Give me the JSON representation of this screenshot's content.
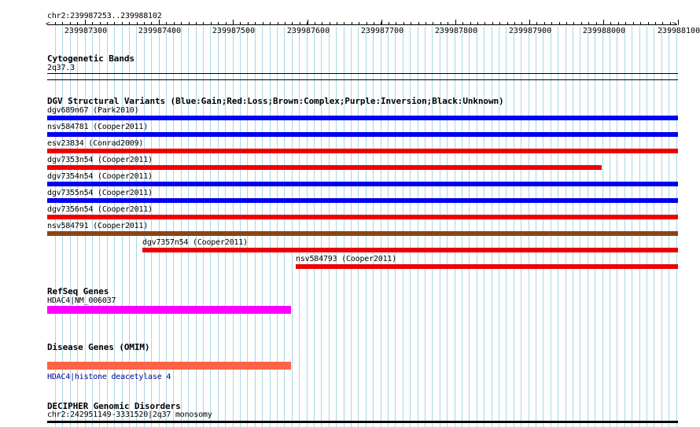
{
  "ruler": {
    "location": "chr2:239987253..239988102",
    "ticks": [
      "239987300",
      "239987400",
      "239987500",
      "239987600",
      "239987700",
      "239987800",
      "239987900",
      "239988000",
      "239988100"
    ]
  },
  "cytoband": {
    "title": "Cytogenetic Bands",
    "label": "2q37.3"
  },
  "dgv": {
    "title": "DGV Structural Variants (Blue:Gain;Red:Loss;Brown:Complex;Purple:Inversion;Black:Unknown)",
    "colors": {
      "gain": "#0000ee",
      "loss": "#ee0000",
      "complex": "#8b4513"
    },
    "variants": [
      {
        "label": "dgv689n67 (Park2010)",
        "type": "gain"
      },
      {
        "label": "nsv584781 (Cooper2011)",
        "type": "gain"
      },
      {
        "label": "esv23834 (Conrad2009)",
        "type": "loss"
      },
      {
        "label": "dgv7353n54 (Cooper2011)",
        "type": "loss"
      },
      {
        "label": "dgv7354n54 (Cooper2011)",
        "type": "gain"
      },
      {
        "label": "dgv7355n54 (Cooper2011)",
        "type": "gain"
      },
      {
        "label": "dgv7356n54 (Cooper2011)",
        "type": "loss"
      },
      {
        "label": "nsv584791 (Cooper2011)",
        "type": "complex"
      },
      {
        "label": "dgv7357n54 (Cooper2011)",
        "type": "loss"
      },
      {
        "label": "nsv584793 (Cooper2011)",
        "type": "loss"
      }
    ]
  },
  "refseq": {
    "title": "RefSeq Genes",
    "gene_label": "HDAC4|NM_006037",
    "color": "#ff00ff"
  },
  "omim": {
    "title": "Disease Genes (OMIM)",
    "gene_label": "HDAC4|histone deacetylase 4",
    "color": "#ff6347"
  },
  "decipher": {
    "title": "DECIPHER Genomic Disorders",
    "label": "chr2:242951149-3331520|2q37 monosomy"
  }
}
